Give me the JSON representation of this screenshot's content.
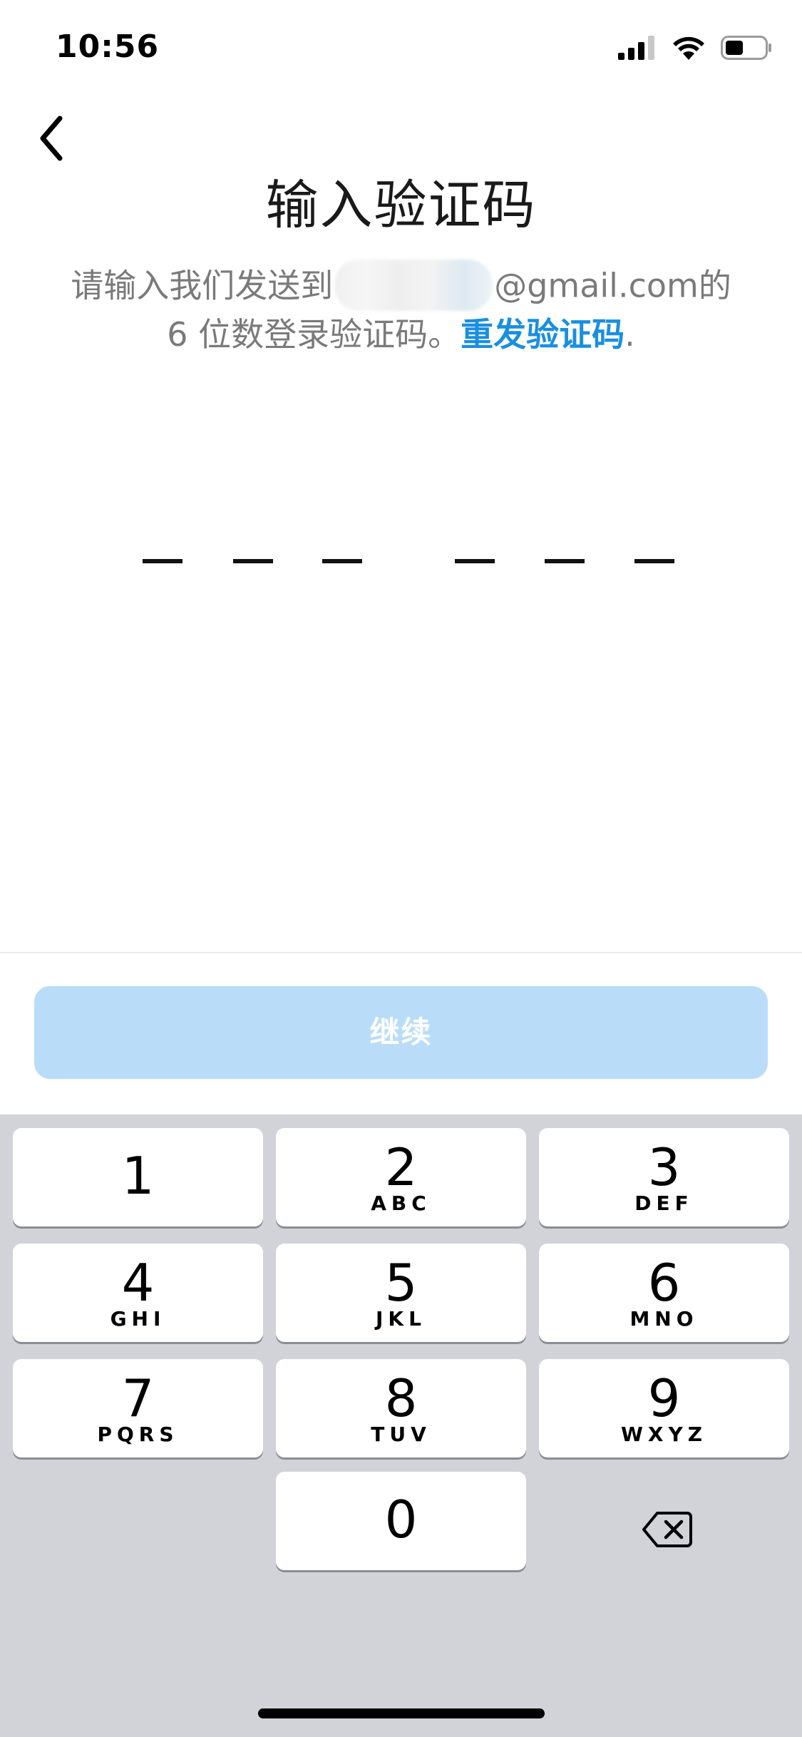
{
  "status_bar": {
    "time": "10:56",
    "signal_icon": "cellular-signal-icon",
    "wifi_icon": "wifi-icon",
    "battery_icon": "battery-icon"
  },
  "nav": {
    "back_icon": "chevron-left-icon"
  },
  "title": "输入验证码",
  "instruction": {
    "prefix": "请输入我们发送到",
    "email_suffix": "@gmail.com",
    "suffix_line1": "的",
    "line2_text": "6 位数登录验证码。",
    "resend_label": "重发验证码",
    "line2_end": "."
  },
  "code": {
    "digits": [
      "",
      "",
      "",
      "",
      "",
      ""
    ]
  },
  "continue_label": "继续",
  "keypad": {
    "keys": [
      {
        "digit": "1",
        "letters": ""
      },
      {
        "digit": "2",
        "letters": "ABC"
      },
      {
        "digit": "3",
        "letters": "DEF"
      },
      {
        "digit": "4",
        "letters": "GHI"
      },
      {
        "digit": "5",
        "letters": "JKL"
      },
      {
        "digit": "6",
        "letters": "MNO"
      },
      {
        "digit": "7",
        "letters": "PQRS"
      },
      {
        "digit": "8",
        "letters": "TUV"
      },
      {
        "digit": "9",
        "letters": "WXYZ"
      },
      {
        "digit": "0",
        "letters": ""
      }
    ],
    "backspace_icon": "backspace-icon"
  },
  "colors": {
    "accent": "#1a8fe0",
    "button_disabled": "#b9ddf8",
    "keyboard_bg": "#d1d3d9"
  }
}
